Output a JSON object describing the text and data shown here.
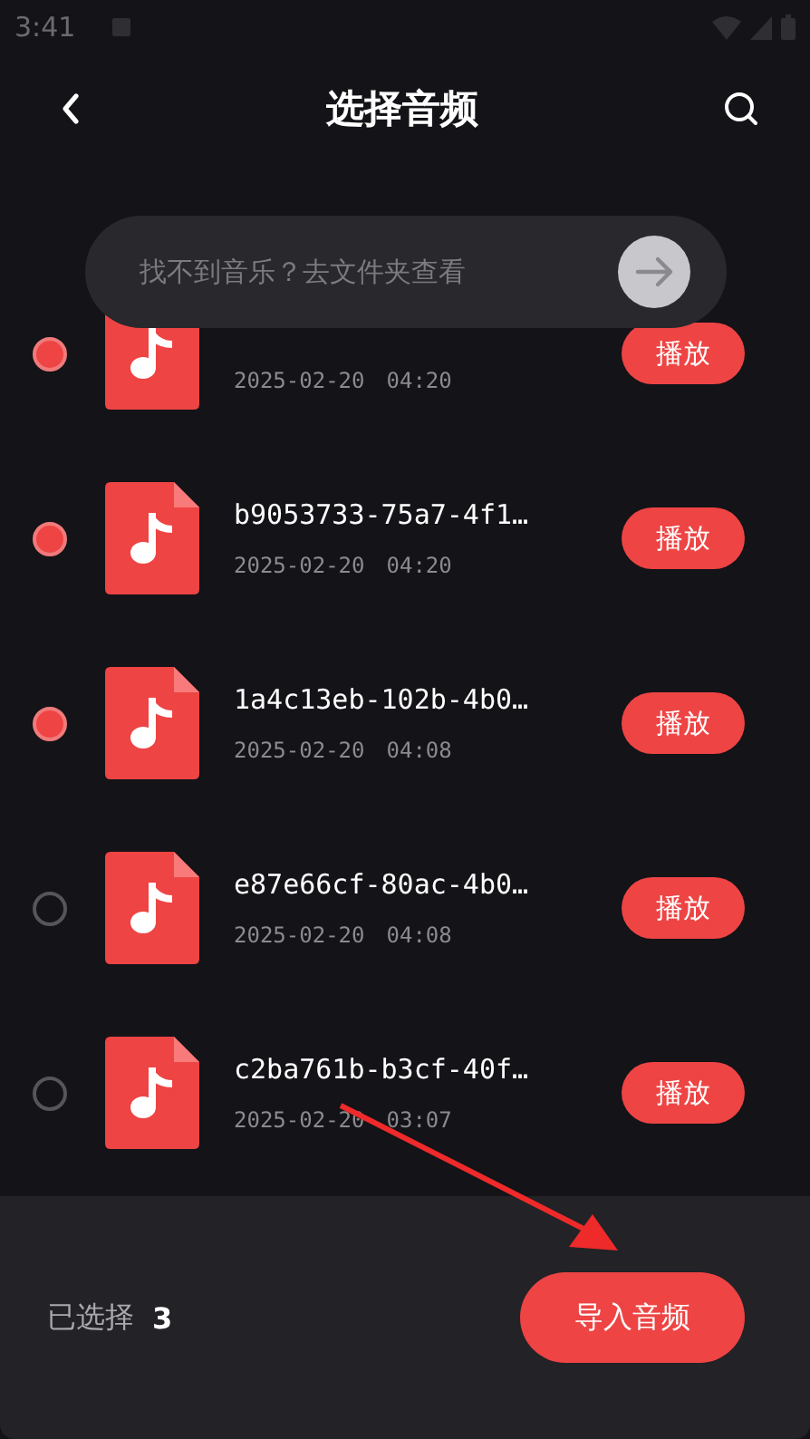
{
  "status_bar": {
    "time": "3:41"
  },
  "header": {
    "title": "选择音频"
  },
  "folder_hint": {
    "text": "找不到音乐？去文件夹查看"
  },
  "files": [
    {
      "date": "2025-02-20",
      "time": "04:20",
      "selected": true,
      "action": "播放"
    },
    {
      "name": "b9053733-75a7-4f1…",
      "date": "2025-02-20",
      "time": "04:20",
      "selected": true,
      "action": "播放"
    },
    {
      "name": "1a4c13eb-102b-4b0…",
      "date": "2025-02-20",
      "time": "04:08",
      "selected": true,
      "action": "播放"
    },
    {
      "name": "e87e66cf-80ac-4b0…",
      "date": "2025-02-20",
      "time": "04:08",
      "selected": false,
      "action": "播放"
    },
    {
      "name": "c2ba761b-b3cf-40f…",
      "date": "2025-02-20",
      "time": "03:07",
      "selected": false,
      "action": "播放"
    }
  ],
  "footer": {
    "selected_label": "已选择",
    "selected_count": "3",
    "import_button": "导入音频"
  }
}
